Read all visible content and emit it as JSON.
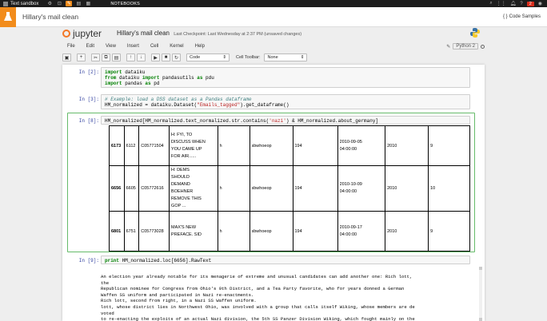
{
  "topbar": {
    "app_name": "Text sandbox",
    "notebooks": "NOTEBOOKS",
    "notification_count": "2"
  },
  "header2": {
    "notebook_name": "Hillary's mail clean",
    "code_samples": "Code Samples"
  },
  "jupyter": {
    "logo_text": "jupyter",
    "title": "Hillary's mail clean",
    "checkpoint": "Last Checkpoint: Last Wednesday at 2:37 PM (unsaved changes)"
  },
  "menu": [
    "File",
    "Edit",
    "View",
    "Insert",
    "Cell",
    "Kernel",
    "Help"
  ],
  "kernel": "Python 2",
  "toolbar": {
    "cell_type": "Code",
    "cell_toolbar_label": "Cell Toolbar:",
    "cell_toolbar_value": "None"
  },
  "cells": [
    {
      "prompt": "In [2]:",
      "lines": [
        [
          {
            "t": "import",
            "c": "kw"
          },
          {
            "t": " dataiku",
            "c": ""
          }
        ],
        [
          {
            "t": "from",
            "c": "kw"
          },
          {
            "t": " dataiku ",
            "c": ""
          },
          {
            "t": "import",
            "c": "kw"
          },
          {
            "t": " pandasutils ",
            "c": ""
          },
          {
            "t": "as",
            "c": "kw"
          },
          {
            "t": " pdu",
            "c": ""
          }
        ],
        [
          {
            "t": "import",
            "c": "kw"
          },
          {
            "t": " pandas ",
            "c": ""
          },
          {
            "t": "as",
            "c": "kw"
          },
          {
            "t": " pd",
            "c": ""
          }
        ]
      ]
    },
    {
      "prompt": "In [3]:",
      "lines": [
        [
          {
            "t": "# Example: load a DSS dataset as a Pandas dataframe",
            "c": "cm"
          }
        ],
        [
          {
            "t": "HM_normalized = dataiku.Dataset(",
            "c": ""
          },
          {
            "t": "\"Emails_tagged\"",
            "c": "st"
          },
          {
            "t": ").get_dataframe()",
            "c": ""
          }
        ]
      ]
    },
    {
      "prompt": "In [8]:",
      "lines": [
        [
          {
            "t": "HM_normalized[HM_normalized.text_normalized.str.contains(",
            "c": ""
          },
          {
            "t": "'nazi'",
            "c": "st"
          },
          {
            "t": ") & HM_normalized.about_germany]",
            "c": ""
          }
        ]
      ]
    },
    {
      "prompt": "In [9]:",
      "lines": [
        [
          {
            "t": "print",
            "c": "kw"
          },
          {
            "t": " HM_normalized.loc[6656].RawText",
            "c": ""
          }
        ]
      ]
    }
  ],
  "table_rows": [
    {
      "index": "6173",
      "id": "6112",
      "doc": "C05771504",
      "subject": [
        "H: FYI, TO",
        "DISCUSS WHEN",
        "YOU CAME UP",
        "FOR AIR......"
      ],
      "from": "h",
      "to": "sbwhoeop",
      "n": "194",
      "date": [
        "2010-09-05",
        "04:00:00"
      ],
      "year": "2010",
      "month": "9"
    },
    {
      "index": "6656",
      "id": "6605",
      "doc": "C05772616",
      "subject": [
        "H: DEMS",
        "SHOULD",
        "DEMAND",
        "BOEHNER",
        "REMOVE THIS",
        "GOP ..."
      ],
      "from": "h",
      "to": "sbwhoeop",
      "n": "194",
      "date": [
        "2010-10-09",
        "04:00:00"
      ],
      "year": "2010",
      "month": "10"
    },
    {
      "index": "6801",
      "id": "6751",
      "doc": "C05773028",
      "subject": [
        "MAX'S NEW",
        "PREFACE. SID"
      ],
      "from": "h",
      "to": "sbwhoeop",
      "n": "194",
      "date": [
        "2010-09-17",
        "04:00:00"
      ],
      "year": "2010",
      "month": "9"
    }
  ],
  "raw_text": [
    "An election year already notable for its menagerie of extreme and unusual candidates can add another one: Rich lott,",
    "the",
    "Republican nominee for Congress from Ohio's 9th District, and a Tea Party favorite, who for years donned a German",
    "Waffen SS uniform and participated in Nazi re-enactments.",
    "Rich lott, second from right, in a Nazi SS Waffen uniform.",
    "lott, whose district lies in Northwest Ohio, was involved with a group that calls itself Wiking, whose members are de",
    "voted",
    "to re-enacting the exploits of an actual Nazi division, the 5th SS Panzer Division Wiking, which fought mainly on the",
    "Eastern Front during World War 11. lott's participation in the Wiking group is not mentioned on his campaign's websit"
  ]
}
